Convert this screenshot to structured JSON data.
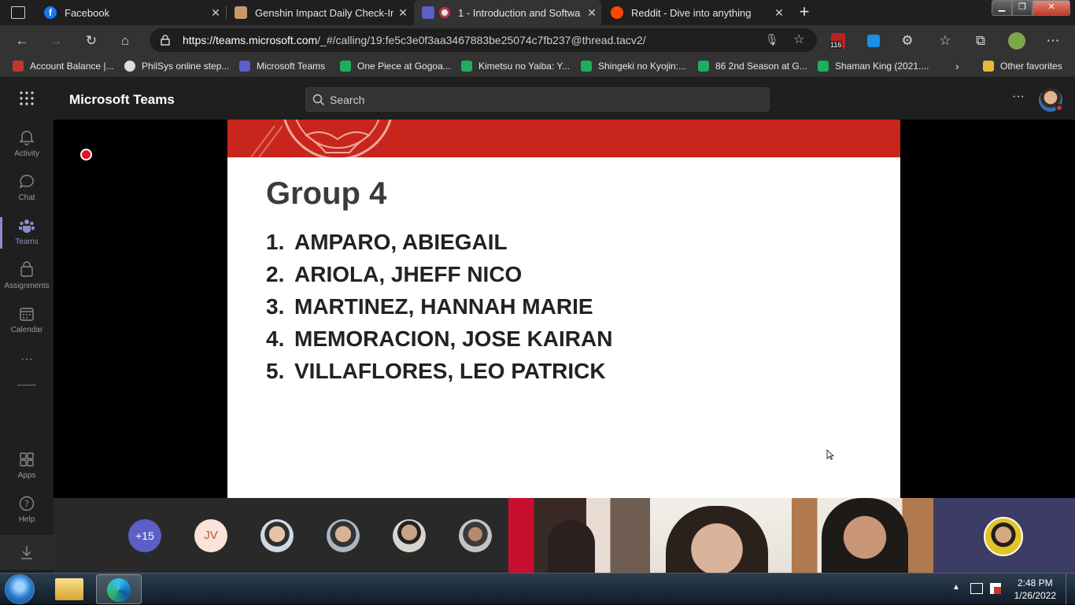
{
  "browser": {
    "tabs": [
      {
        "title": "Facebook",
        "close": "✕"
      },
      {
        "title": "Genshin Impact Daily Check-In",
        "close": "✕"
      },
      {
        "title": "1 - Introduction and Softwa",
        "close": "✕"
      },
      {
        "title": "Reddit - Dive into anything",
        "close": "✕"
      }
    ],
    "new_tab": "+",
    "url_domain": "https://teams.microsoft.com",
    "url_path": "/_#/calling/19:fe5c3e0f3aa3467883be25074c7fb237@thread.tacv2/",
    "extension_badge": "116",
    "favorites": [
      "Account Balance |...",
      "PhilSys online step...",
      "Microsoft Teams",
      "One Piece at Gogoa...",
      "Kimetsu no Yaiba: Y...",
      "Shingeki no Kyojin:...",
      "86 2nd Season at G...",
      "Shaman King (2021...."
    ],
    "other_favorites": "Other favorites"
  },
  "teams": {
    "app_name": "Microsoft Teams",
    "search_placeholder": "Search",
    "more": "···",
    "rail": [
      "Activity",
      "Chat",
      "Teams",
      "Assignments",
      "Calendar",
      "Apps",
      "Help"
    ],
    "rail_more": "···"
  },
  "slide": {
    "title": "Group 4",
    "items": [
      {
        "num": "1.",
        "name": "AMPARO, ABIEGAIL"
      },
      {
        "num": "2.",
        "name": "ARIOLA, JHEFF NICO"
      },
      {
        "num": "3.",
        "name": "MARTINEZ, HANNAH MARIE"
      },
      {
        "num": "4.",
        "name": "MEMORACION, JOSE KAIRAN"
      },
      {
        "num": "5.",
        "name": "VILLAFLORES, LEO PATRICK"
      }
    ]
  },
  "participants": {
    "overflow": "+15",
    "initials": "JV"
  },
  "taskbar": {
    "time": "2:48 PM",
    "date": "1/26/2022"
  }
}
